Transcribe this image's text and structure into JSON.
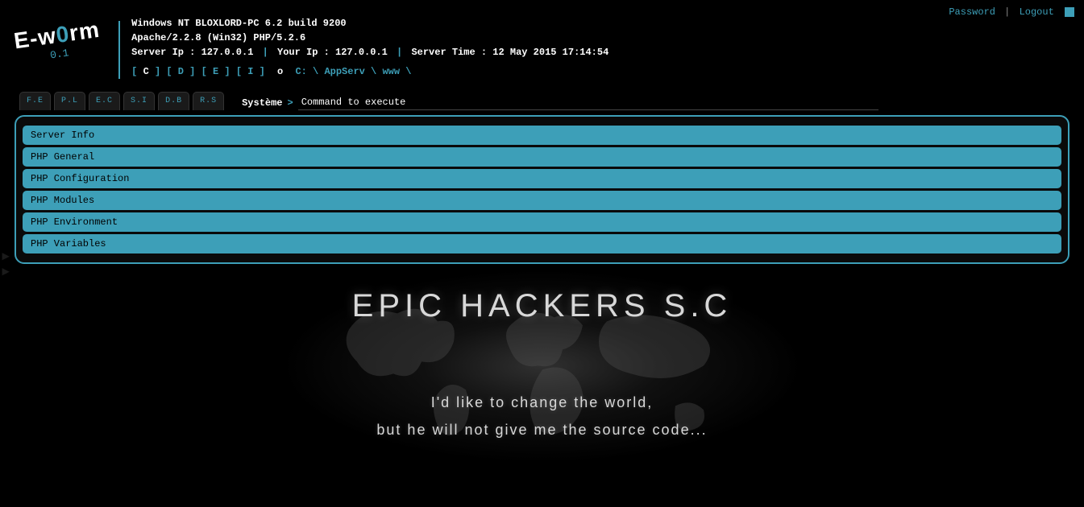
{
  "topbar": {
    "password": "Password",
    "logout": "Logout"
  },
  "logo": {
    "pre": "E-w",
    "zero": "0",
    "post": "rm",
    "ver": "0.1"
  },
  "info": {
    "os": "Windows NT BLOXLORD-PC 6.2 build 9200",
    "srv": "Apache/2.2.8 (Win32) PHP/5.2.6",
    "server_ip_label": "Server Ip : ",
    "server_ip": "127.0.0.1",
    "your_ip_label": "Your Ip : ",
    "your_ip": "127.0.0.1",
    "time_label": "Server Time : ",
    "time": "12 May 2015 17:14:54"
  },
  "drives": {
    "items": [
      {
        "l": "[ ",
        "v": "C",
        "r": " ]",
        "cur": true
      },
      {
        "l": "[ ",
        "v": "D",
        "r": " ]",
        "cur": false
      },
      {
        "l": "[ ",
        "v": "E",
        "r": " ]",
        "cur": false
      },
      {
        "l": "[ ",
        "v": "I",
        "r": " ]",
        "cur": false
      }
    ],
    "o": "o",
    "path": "C: \\ AppServ \\ www \\"
  },
  "tabs": [
    "F.E",
    "P.L",
    "E.C",
    "S.I",
    "D.B",
    "R.S"
  ],
  "prompt": {
    "label": "Système",
    "gt": ">",
    "value": "Command to execute"
  },
  "bars": [
    "Server Info",
    "PHP General",
    "PHP Configuration",
    "PHP Modules",
    "PHP Environment",
    "PHP Variables"
  ],
  "hero": {
    "title": "EPIC HACKERS S.C",
    "line1": "I'd like to change the world,",
    "line2": "but he will not give me the source code..."
  }
}
